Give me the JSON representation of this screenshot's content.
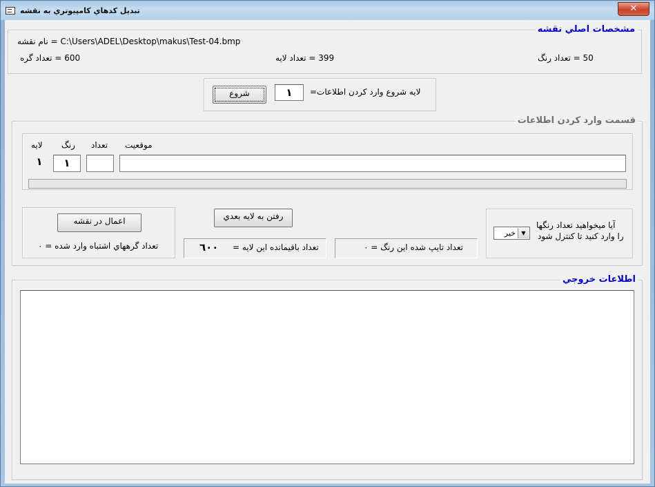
{
  "window": {
    "title": "تبديل كدهاي كامپيوتري به نقشه",
    "close_label": "✕"
  },
  "map_info": {
    "legend": "مشخصات اصلي نقشه",
    "map_name": "C:\\Users\\ADEL\\Desktop\\makus\\Test-04.bmp = نام نقشه",
    "node_count": "600  = تعداد گره",
    "layer_count": "399 = تعداد لايه",
    "color_count": "50 = تعداد رنگ"
  },
  "start": {
    "label": "لايه شروع وارد كردن اطلاعات=",
    "value": "١",
    "button": "شروع"
  },
  "entry": {
    "legend": "قسمت وارد كردن اطلاعات",
    "col_position": "موقعيت",
    "col_count": "تعداد",
    "col_color": "رنگ",
    "col_layer": "لايه",
    "layer_value": "١",
    "color_value": "١",
    "count_value": "",
    "position_value": "",
    "progress": 0
  },
  "actions": {
    "apply_button": "اعمال در نقشه",
    "next_layer_button": "رفتن به لايه بعدي",
    "wrong_nodes": "تعداد گرههاي اشتباه وارد شده = ٠",
    "remaining_label": "تعداد باقيمانده اين لايه =",
    "remaining_value": "٦٠٠",
    "typed_count": "تعداد تايپ شده اين رنگ = ٠",
    "control_question_1": "آيا ميخواهيد تعداد رنگها",
    "control_question_2": "را وارد كنيد تا كنترل شود",
    "control_select": "خير"
  },
  "output": {
    "legend": "اطلاعات خروجي",
    "content": ""
  }
}
